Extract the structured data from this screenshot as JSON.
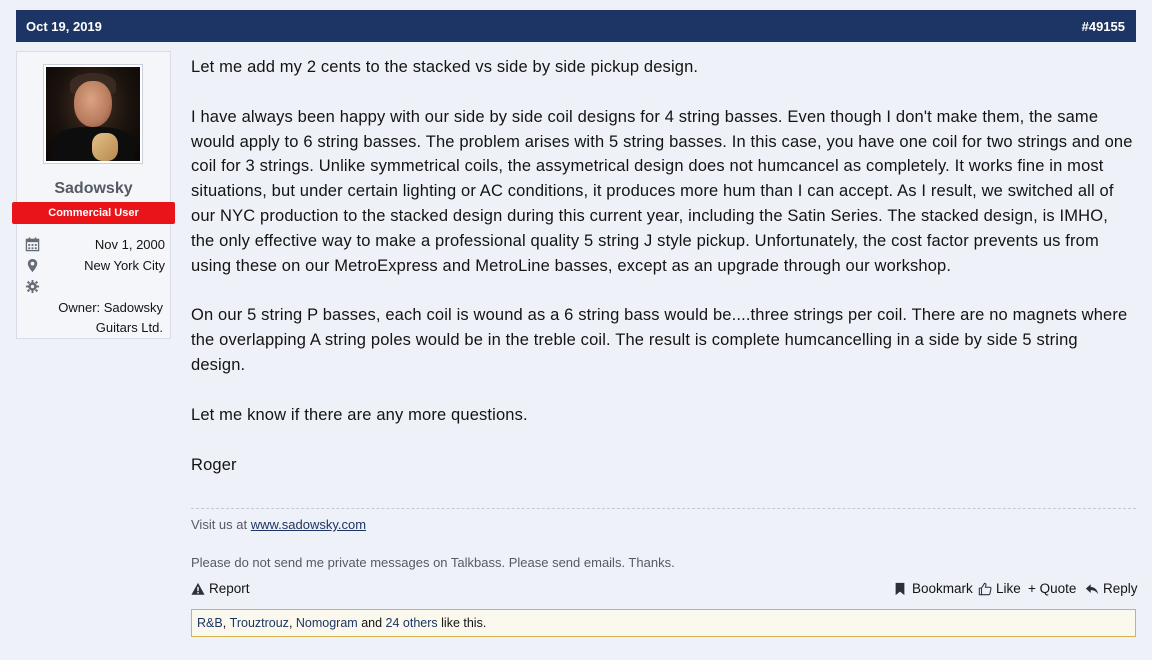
{
  "post": {
    "date": "Oct 19, 2019",
    "number": "#49155"
  },
  "user": {
    "name": "Sadowsky",
    "title": "Commercial User",
    "joined": "Nov 1, 2000",
    "location": "New York City",
    "occupation_line1": "Owner: Sadowsky",
    "occupation_line2": "Guitars Ltd."
  },
  "message": {
    "p1": "Let me add my 2 cents to the stacked vs side by side pickup design.",
    "p2": "I have always been happy with our side by side coil designs for 4 string basses. Even though I don't make them, the same would apply to 6 string basses. The problem arises with 5 string basses. In this case, you have one coil for two strings and one coil for 3 strings. Unlike symmetrical coils, the assymetrical design does not humcancel as completely. It works fine in most situations, but under certain lighting or AC conditions, it produces more hum than I can accept. As I result, we switched all of our NYC production to the stacked design during this current year, including the Satin Series. The stacked design, is IMHO, the only effective way to make a professional quality 5 string J style pickup. Unfortunately, the cost factor prevents us from using these on our MetroExpress and MetroLine basses, except as an upgrade through our workshop.",
    "p3": "On our 5 string P basses, each coil is wound as a 6 string bass would be....three strings per coil. There are no magnets where the overlapping A string poles would be in the treble coil. The result is complete humcancelling in a side by side 5 string design.",
    "p4": "Let me know if there are any more questions.",
    "sign": "Roger"
  },
  "signature": {
    "prefix": "Visit us at ",
    "link": "www.sadowsky.com",
    "note": "Please do not send me private messages on Talkbass. Please send emails. Thanks."
  },
  "actions": {
    "report": "Report",
    "bookmark": "Bookmark",
    "like": "Like",
    "quote": "+ Quote",
    "reply": "Reply"
  },
  "likes": {
    "user1": "R&B",
    "user2": "Trouztrouz",
    "user3": "Nomogram",
    "and": "and",
    "others": "24 others",
    "suffix": "like this."
  },
  "colors": {
    "header_bg": "#1d3564",
    "title_badge": "#e8141a",
    "likes_border": "#d8b24a"
  },
  "icons": [
    "calendar-icon",
    "map-marker-icon",
    "gear-icon",
    "warning-icon",
    "bookmark-icon",
    "thumbs-up-icon",
    "reply-icon"
  ]
}
